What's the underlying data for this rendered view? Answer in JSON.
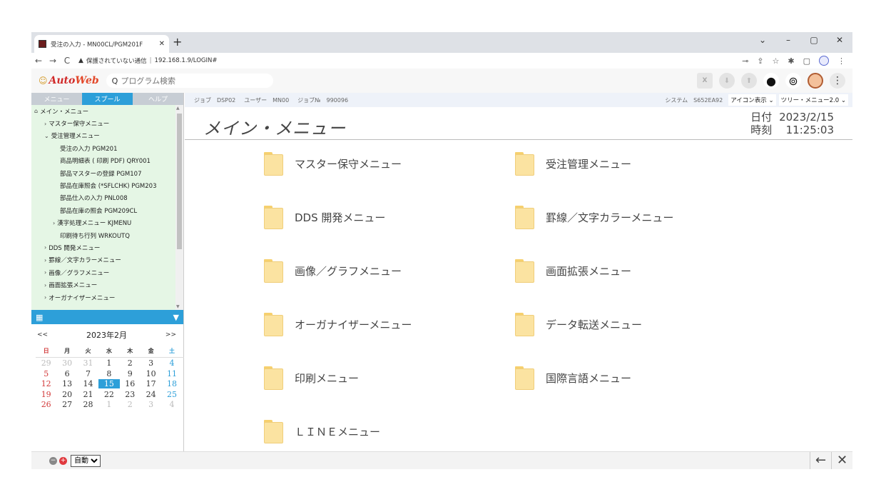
{
  "browser": {
    "tab_title": "受注の入力 - MN00CL/PGM201F",
    "tab_close": "✕",
    "new_tab": "+",
    "window_controls": [
      "⌄",
      "–",
      "▢",
      "✕"
    ],
    "nav": {
      "back": "←",
      "forward": "→",
      "reload": "C"
    },
    "security_label": "保護されていない通信",
    "url": "192.168.1.9/LOGIN#"
  },
  "toolbar": {
    "logo_text_a": "Auto",
    "logo_text_b": "Web",
    "search_placeholder": "プログラム検索",
    "search_icon": "search-icon",
    "icons": [
      "excel-icon",
      "download-icon",
      "upload-icon",
      "messenger-icon",
      "arrow-down-circle-icon",
      "user-avatar-icon",
      "more-icon"
    ]
  },
  "sidebar": {
    "tabs": [
      "メニュー",
      "スプール",
      "ヘルプ"
    ],
    "active_tab": "スプール",
    "tree": [
      {
        "label": "メイン・メニュー",
        "indent": 0,
        "icon": "home"
      },
      {
        "label": "マスター保守メニュー",
        "indent": 1,
        "icon": "›"
      },
      {
        "label": "受注管理メニュー",
        "indent": 1,
        "icon": "⌄"
      },
      {
        "label": "受注の入力 PGM201",
        "indent": 2,
        "icon": ""
      },
      {
        "label": "商品明細表 ( 印刷 PDF) QRY001",
        "indent": 2,
        "icon": ""
      },
      {
        "label": "部品マスターの登録 PGM107",
        "indent": 2,
        "icon": ""
      },
      {
        "label": "部品在庫照会 (*SFLCHK) PGM203",
        "indent": 2,
        "icon": ""
      },
      {
        "label": "部品仕入の入力 PNL008",
        "indent": 2,
        "icon": ""
      },
      {
        "label": "部品在庫の照会 PGM209CL",
        "indent": 2,
        "icon": ""
      },
      {
        "label": "漢字処理メニュー KJMENU",
        "indent": 2,
        "icon": "›"
      },
      {
        "label": "印刷待ち行列 WRKOUTQ",
        "indent": 2,
        "icon": ""
      },
      {
        "label": "DDS 開発メニュー",
        "indent": 1,
        "icon": "›"
      },
      {
        "label": "罫線／文字カラーメニュー",
        "indent": 1,
        "icon": "›"
      },
      {
        "label": "画像／グラフメニュー",
        "indent": 1,
        "icon": "›"
      },
      {
        "label": "画面拡張メニュー",
        "indent": 1,
        "icon": "›"
      },
      {
        "label": "オーガナイザーメニュー",
        "indent": 1,
        "icon": "›"
      }
    ]
  },
  "calendar": {
    "prev": "<<",
    "next": ">>",
    "month_label": "2023年2月",
    "weekdays": [
      "日",
      "月",
      "火",
      "水",
      "木",
      "金",
      "土"
    ],
    "weeks": [
      [
        "29",
        "30",
        "31",
        "1",
        "2",
        "3",
        "4"
      ],
      [
        "5",
        "6",
        "7",
        "8",
        "9",
        "10",
        "11"
      ],
      [
        "12",
        "13",
        "14",
        "15",
        "16",
        "17",
        "18"
      ],
      [
        "19",
        "20",
        "21",
        "22",
        "23",
        "24",
        "25"
      ],
      [
        "26",
        "27",
        "28",
        "1",
        "2",
        "3",
        "4"
      ]
    ],
    "today": "15"
  },
  "infobar": {
    "job_label": "ジョブ",
    "job_value": "DSP02",
    "user_label": "ユーザー",
    "user_value": "MN00",
    "jobno_label": "ジョブ№",
    "jobno_value": "990096",
    "system_label": "システム",
    "system_value": "S652EA92",
    "icon_display": "アイコン表示",
    "tree_menu": "ツリー・メニュー2.0"
  },
  "page": {
    "title": "メイン・メニュー",
    "date_label": "日付",
    "date_value": "2023/2/15",
    "time_label": "時刻",
    "time_value": "11:25:03"
  },
  "menu_items": [
    "マスター保守メニュー",
    "受注管理メニュー",
    "DDS 開発メニュー",
    "罫線／文字カラーメニュー",
    "画像／グラフメニュー",
    "画面拡張メニュー",
    "オーガナイザーメニュー",
    "データ転送メニュー",
    "印刷メニュー",
    "国際言語メニュー",
    "ＬＩＮＥメニュー"
  ],
  "statusbar": {
    "select_value": "自動",
    "back": "←",
    "close": "✕"
  },
  "colors": {
    "accent": "#2d9fd9",
    "tree_bg": "#e5f6e5",
    "folder": "#fbe3a1",
    "sunday": "#d23a3a",
    "saturday": "#2d9fd9"
  }
}
